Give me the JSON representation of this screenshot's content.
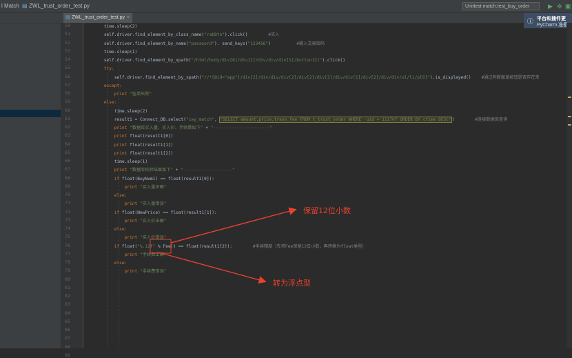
{
  "titlebar": {
    "app_fragment": "l Match",
    "file": "ZWL_trust_order_test.py",
    "run_config": "Unittest match.test_buy_order"
  },
  "tab": {
    "label": "ZWL_trust_order_test.py",
    "close": "×"
  },
  "notification": {
    "line1": "平台和插件更",
    "line2": "PyCharm 准备"
  },
  "gutter_lines": [
    "50",
    "51",
    "52",
    "53",
    "54",
    "55",
    "56",
    "57",
    "58",
    "59",
    "60",
    "61",
    "62",
    "63",
    "64",
    "65",
    "66",
    "67",
    "68",
    "69",
    "70",
    "71",
    "72",
    "73",
    "74",
    "75",
    "76",
    "77",
    "78",
    "79",
    "80",
    "81",
    "82",
    "83",
    "84",
    "85",
    "86",
    "87",
    "88",
    "89"
  ],
  "code": [
    {
      "indent": "        ",
      "parts": [
        [
          "fn",
          "time.sleep(2)"
        ]
      ]
    },
    {
      "indent": "        ",
      "parts": [
        [
          "fn",
          "self.driver.find_element_by_class_name("
        ],
        [
          "str",
          "\"rabBtn\""
        ],
        [
          "fn",
          ").click()        "
        ],
        [
          "cm",
          "#买入"
        ]
      ]
    },
    {
      "indent": "        ",
      "parts": [
        [
          "fn",
          "self.driver.find_element_by_name("
        ],
        [
          "str",
          "\"password\""
        ],
        [
          "fn",
          "). send_keys("
        ],
        [
          "str",
          "\"123456\""
        ],
        [
          "fn",
          ")          "
        ],
        [
          "cm",
          "#输入交易密码"
        ]
      ]
    },
    {
      "indent": "        ",
      "parts": [
        [
          "fn",
          "time.sleep(1)"
        ]
      ]
    },
    {
      "indent": "        ",
      "parts": [
        [
          "fn",
          "self.driver.find_element_by_xpath("
        ],
        [
          "str",
          "\"/html/body/div[6]/div[2]/div/div/div[1]/button[2]\""
        ],
        [
          "fn",
          ").click()"
        ]
      ]
    },
    {
      "indent": "        ",
      "parts": [
        [
          "kw",
          "try:"
        ]
      ]
    },
    {
      "indent": "            ",
      "parts": [
        [
          "fn",
          "self.driver.find_element_by_xpath("
        ],
        [
          "str",
          "\"//*[@id=\"app\"]/div[2]/div/div/div[2]/div[2]/div[2]/div/div[1]/div[2]/div/div/ul/li/p[6]\""
        ],
        [
          "fn",
          ").is_displayed()    "
        ],
        [
          "cm",
          "#通过判断撤单按钮是否存在来"
        ]
      ]
    },
    {
      "indent": "        ",
      "parts": [
        [
          "kw",
          "except:"
        ]
      ]
    },
    {
      "indent": "            ",
      "parts": [
        [
          "kw",
          "print "
        ],
        [
          "str",
          "\"挂单失败\""
        ]
      ]
    },
    {
      "indent": "        ",
      "parts": [
        [
          "kw",
          "else:"
        ]
      ]
    },
    {
      "indent": "            ",
      "parts": [
        [
          "fn",
          "time.sleep(2)"
        ]
      ]
    },
    {
      "indent": "            ",
      "parts": [
        [
          "fn",
          "result1 = Connect_DB.select("
        ],
        [
          "str",
          "\"cwy_match\""
        ],
        [
          "fn",
          ", "
        ],
        [
          "sql",
          "\"SELECT amount,price,trans_fee FROM t_trust_order WHERE  uid = 111707 ORDER BY ctime DESC\""
        ],
        [
          "fn",
          ")        "
        ],
        [
          "cm",
          "#连接数据库查询"
        ]
      ]
    },
    {
      "indent": "            ",
      "parts": [
        [
          "kw",
          "print "
        ],
        [
          "str",
          "\"数据库买入量、买入价、手续费如下\""
        ],
        [
          "fn",
          " + "
        ],
        [
          "str",
          "\"----------------------\""
        ]
      ]
    },
    {
      "indent": "            ",
      "parts": [
        [
          "kw",
          "print "
        ],
        [
          "fn",
          "float(result1[0])"
        ]
      ]
    },
    {
      "indent": "            ",
      "parts": [
        [
          "kw",
          "print "
        ],
        [
          "fn",
          "float(result1[1])"
        ]
      ]
    },
    {
      "indent": "            ",
      "parts": [
        [
          "kw",
          "print "
        ],
        [
          "fn",
          "float(result1[2])"
        ]
      ]
    },
    {
      "indent": "            ",
      "parts": [
        [
          "fn",
          "time.sleep(1)"
        ]
      ]
    },
    {
      "indent": "            ",
      "parts": [
        [
          "kw",
          "print "
        ],
        [
          "str",
          "\"数据库校验结果如下\""
        ],
        [
          "fn",
          " + "
        ],
        [
          "str",
          "\"-------------------\""
        ]
      ]
    },
    {
      "indent": "            ",
      "parts": [
        [
          "kw",
          "if "
        ],
        [
          "fn",
          "float(BuyNum1) == float(result1[0]):"
        ]
      ]
    },
    {
      "indent": "                ",
      "parts": [
        [
          "kw",
          "print "
        ],
        [
          "str",
          "\"买入量正确\""
        ]
      ]
    },
    {
      "indent": "            ",
      "parts": [
        [
          "kw",
          "else:"
        ]
      ]
    },
    {
      "indent": "                ",
      "parts": [
        [
          "kw",
          "print "
        ],
        [
          "str",
          "\"买入量错误\""
        ]
      ]
    },
    {
      "indent": "            ",
      "parts": [
        [
          "kw",
          "if "
        ],
        [
          "fn",
          "float(NewPrice) == float(result1[1]):"
        ]
      ]
    },
    {
      "indent": "                ",
      "parts": [
        [
          "kw",
          "print "
        ],
        [
          "str",
          "\"买入价正确\""
        ]
      ]
    },
    {
      "indent": "            ",
      "parts": [
        [
          "kw",
          "else:"
        ]
      ]
    },
    {
      "indent": "                ",
      "parts": [
        [
          "kw",
          "print "
        ],
        [
          "str",
          "\"买入价错误\""
        ]
      ]
    },
    {
      "indent": "            ",
      "parts": [
        [
          "kw",
          "if "
        ],
        [
          "fn",
          "float("
        ],
        [
          "str",
          "\"%.12f\""
        ],
        [
          "fn",
          " % Fee)) == float(result1[2]):        "
        ],
        [
          "cm",
          "#手续精度（先将Fee保留12位小数，再转换为float类型）"
        ]
      ]
    },
    {
      "indent": "                ",
      "parts": [
        [
          "kw",
          "print "
        ],
        [
          "str",
          "\"手续费正确\""
        ]
      ]
    },
    {
      "indent": "            ",
      "parts": [
        [
          "kw",
          "else:"
        ]
      ]
    },
    {
      "indent": "                ",
      "parts": [
        [
          "kw",
          "print "
        ],
        [
          "str",
          "\"手续费错误\""
        ]
      ]
    }
  ],
  "annotations": {
    "keep12": "保留12位小数",
    "tofloat": "转为浮点型"
  },
  "colors": {
    "annotation": "#e8412f",
    "keyword": "#cc7832",
    "string": "#6a8759",
    "comment": "#808080"
  }
}
